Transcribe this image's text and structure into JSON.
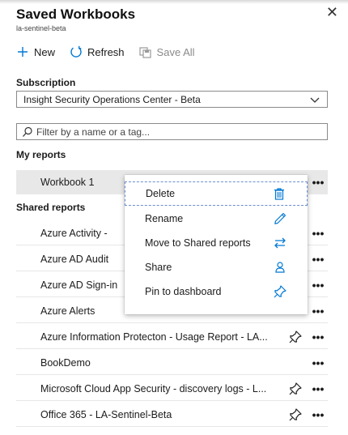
{
  "header": {
    "title": "Saved Workbooks",
    "subtitle": "la-sentinel-beta",
    "close": "✕"
  },
  "toolbar": {
    "new_label": "New",
    "refresh_label": "Refresh",
    "save_all_label": "Save All"
  },
  "subscription": {
    "label": "Subscription",
    "value": "Insight Security Operations Center - Beta"
  },
  "filter": {
    "placeholder": "Filter by a name or a tag..."
  },
  "my_reports": {
    "heading": "My reports",
    "items": [
      {
        "name": "Workbook 1",
        "more": "•••"
      }
    ]
  },
  "shared_reports": {
    "heading": "Shared reports",
    "items": [
      {
        "name": "Azure Activity -",
        "more": "•••"
      },
      {
        "name": "Azure AD Audit",
        "more": "•••"
      },
      {
        "name": "Azure AD Sign-in",
        "more": "•••"
      },
      {
        "name": "Azure Alerts",
        "more": "•••"
      },
      {
        "name": "Azure Information Protecton - Usage Report - LA...",
        "more": "•••",
        "pinned": true
      },
      {
        "name": "BookDemo",
        "more": "•••"
      },
      {
        "name": "Microsoft Cloud App Security - discovery logs - L...",
        "more": "•••",
        "pinned": true
      },
      {
        "name": "Office 365 - LA-Sentinel-Beta",
        "more": "•••",
        "pinned": true
      }
    ]
  },
  "context_menu": {
    "items": [
      {
        "label": "Delete",
        "icon": "trash-icon"
      },
      {
        "label": "Rename",
        "icon": "pencil-icon"
      },
      {
        "label": "Move to Shared reports",
        "icon": "swap-arrows-icon"
      },
      {
        "label": "Share",
        "icon": "share-icon"
      },
      {
        "label": "Pin to dashboard",
        "icon": "pin-icon"
      }
    ]
  },
  "colors": {
    "accent": "#0078d4",
    "selected_row": "#e8e8e8",
    "border": "#8a8a8a"
  }
}
